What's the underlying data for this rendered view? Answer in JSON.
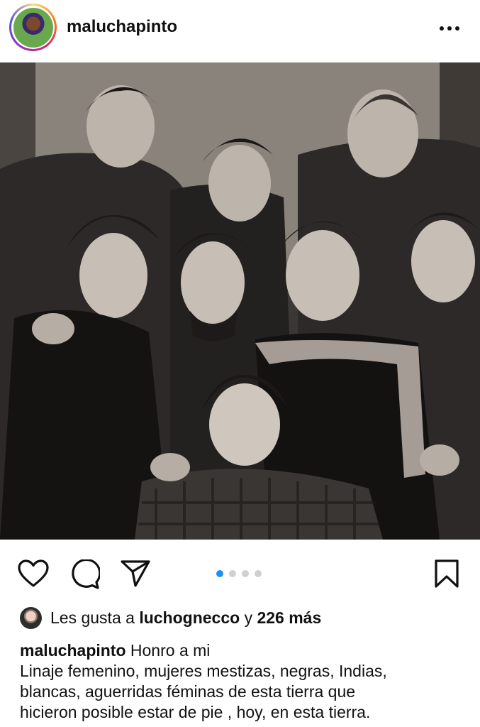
{
  "header": {
    "username": "maluchapinto",
    "more_icon": "ellipsis-horizontal-icon"
  },
  "photo": {
    "style": "black-and-white vintage group portrait"
  },
  "actions": {
    "icons": [
      "heart-icon",
      "comment-icon",
      "send-icon",
      "bookmark-icon"
    ],
    "carousel": {
      "current": 1,
      "total": 4
    },
    "active_color": "#1e90f6"
  },
  "likes": {
    "prefix": "Les gusta a",
    "user": "luchognecco",
    "joiner": "y",
    "count": "226 más"
  },
  "caption": {
    "username": "maluchapinto",
    "first_line": "Honro a mi",
    "lines": [
      "Linaje femenino, mujeres mestizas, negras, Indias,",
      "blancas, aguerridas féminas de esta tierra que",
      "hicieron posible estar de pie , hoy, en esta tierra."
    ]
  }
}
